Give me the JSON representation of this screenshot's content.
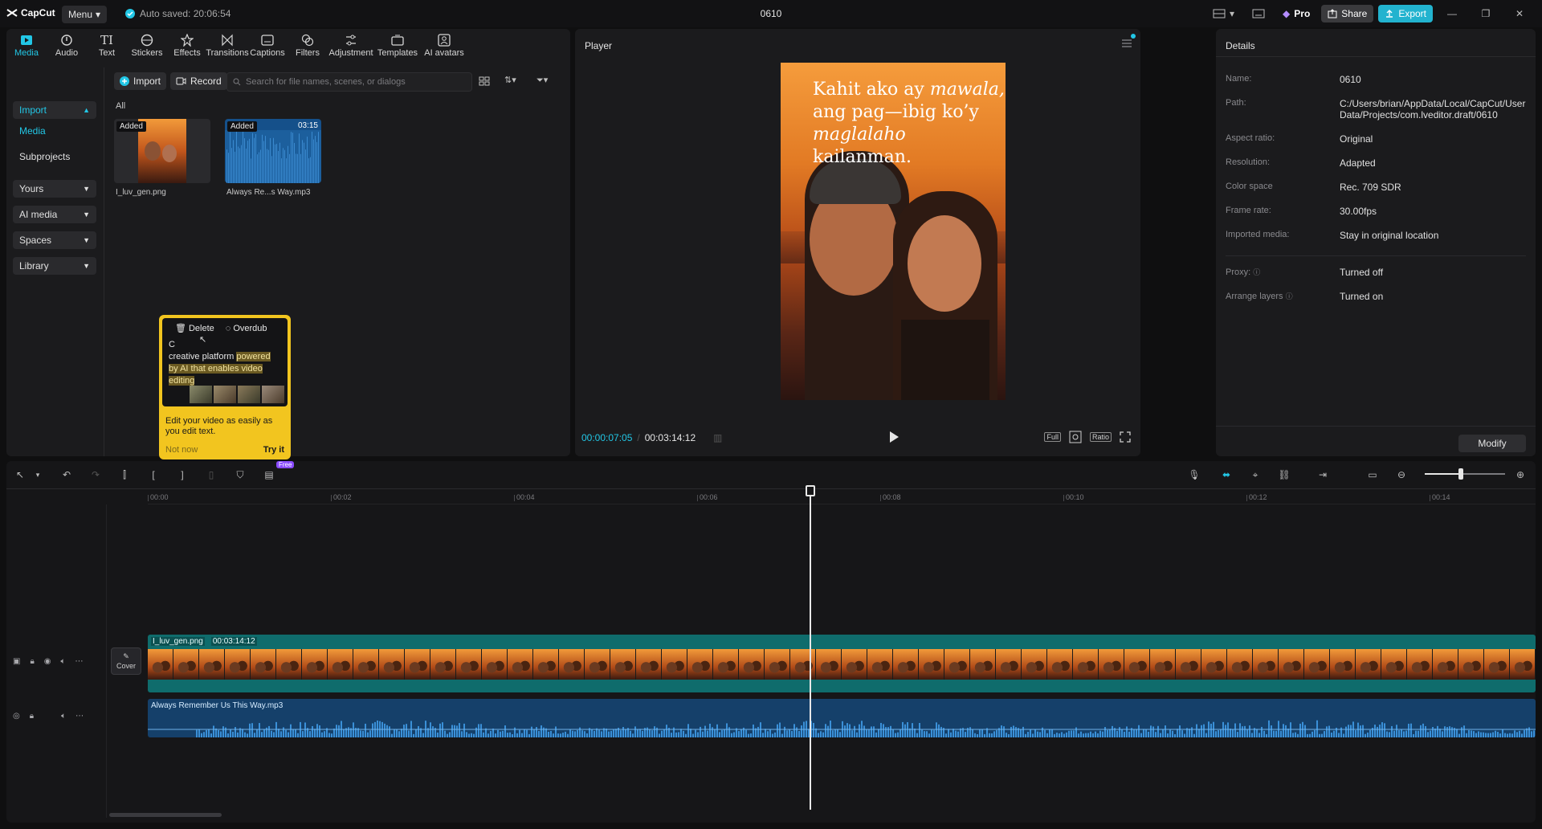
{
  "app": {
    "logo": "CapCut",
    "menu_label": "Menu",
    "autosave": "Auto saved: 20:06:54",
    "project_title": "0610",
    "pro_label": "Pro",
    "share_label": "Share",
    "export_label": "Export"
  },
  "tools": [
    {
      "label": "Media",
      "icon": "media-icon"
    },
    {
      "label": "Audio",
      "icon": "audio-icon"
    },
    {
      "label": "Text",
      "icon": "text-icon"
    },
    {
      "label": "Stickers",
      "icon": "stickers-icon"
    },
    {
      "label": "Effects",
      "icon": "effects-icon"
    },
    {
      "label": "Transitions",
      "icon": "transitions-icon"
    },
    {
      "label": "Captions",
      "icon": "captions-icon"
    },
    {
      "label": "Filters",
      "icon": "filters-icon"
    },
    {
      "label": "Adjustment",
      "icon": "adjustment-icon"
    },
    {
      "label": "Templates",
      "icon": "templates-icon"
    },
    {
      "label": "AI avatars",
      "icon": "ai-avatars-icon"
    }
  ],
  "sidebar": {
    "import": "Import",
    "media": "Media",
    "subprojects": "Subprojects",
    "yours": "Yours",
    "ai_media": "AI media",
    "spaces": "Spaces",
    "library": "Library"
  },
  "media": {
    "import_btn": "Import",
    "record_btn": "Record",
    "search_placeholder": "Search for file names, scenes, or dialogs",
    "filter_all": "All",
    "items": [
      {
        "name": "I_luv_gen.png",
        "badge": "Added",
        "duration": ""
      },
      {
        "name": "Always Re...s Way.mp3",
        "badge": "Added",
        "duration": "03:15"
      }
    ]
  },
  "popup": {
    "delete": "Delete",
    "overdub": "Overdub",
    "text_pre": "C",
    "text_a": "creative platform",
    "text_hl1": "powered",
    "text_hl2": "by AI that enables video",
    "text_hl3": "editing",
    "caption": "Edit your video as easily as you edit text.",
    "not_now": "Not now",
    "try_it": "Try it"
  },
  "player": {
    "title": "Player",
    "caption_line1_pre": "Kahit ako ay ",
    "caption_line1_it": "mawala,",
    "caption_line2": "ang pag—ibig ko’y",
    "caption_line3_it": "maglalaho",
    "caption_line3_post": " kailanman.",
    "current_time": "00:00:07:05",
    "total_time": "00:03:14:12",
    "full_label": "Full",
    "ratio_label": "Ratio"
  },
  "details": {
    "title": "Details",
    "rows": [
      {
        "key": "Name:",
        "value": "0610"
      },
      {
        "key": "Path:",
        "value": "C:/Users/brian/AppData/Local/CapCut/User Data/Projects/com.lveditor.draft/0610"
      },
      {
        "key": "Aspect ratio:",
        "value": "Original"
      },
      {
        "key": "Resolution:",
        "value": "Adapted"
      },
      {
        "key": "Color space",
        "value": "Rec. 709 SDR"
      },
      {
        "key": "Frame rate:",
        "value": "30.00fps"
      },
      {
        "key": "Imported media:",
        "value": "Stay in original location"
      },
      {
        "key": "Proxy:",
        "value": "Turned off"
      },
      {
        "key": "Arrange layers",
        "value": "Turned on"
      }
    ],
    "modify": "Modify"
  },
  "timeline": {
    "free_badge": "Free",
    "ticks": [
      "00:00",
      "00:02",
      "00:04",
      "00:06",
      "00:08",
      "00:10",
      "00:12",
      "00:14"
    ],
    "video_clip_name": "I_luv_gen.png",
    "video_clip_duration": "00:03:14:12",
    "audio_clip_name": "Always Remember Us This Way.mp3",
    "cover_label": "Cover",
    "zoom_level": 0.45
  },
  "colors": {
    "accent": "#22c7e6",
    "export": "#22b3cf",
    "video_track": "#0f6c6c",
    "audio_track": "#15406a",
    "popup": "#f2c51f"
  }
}
